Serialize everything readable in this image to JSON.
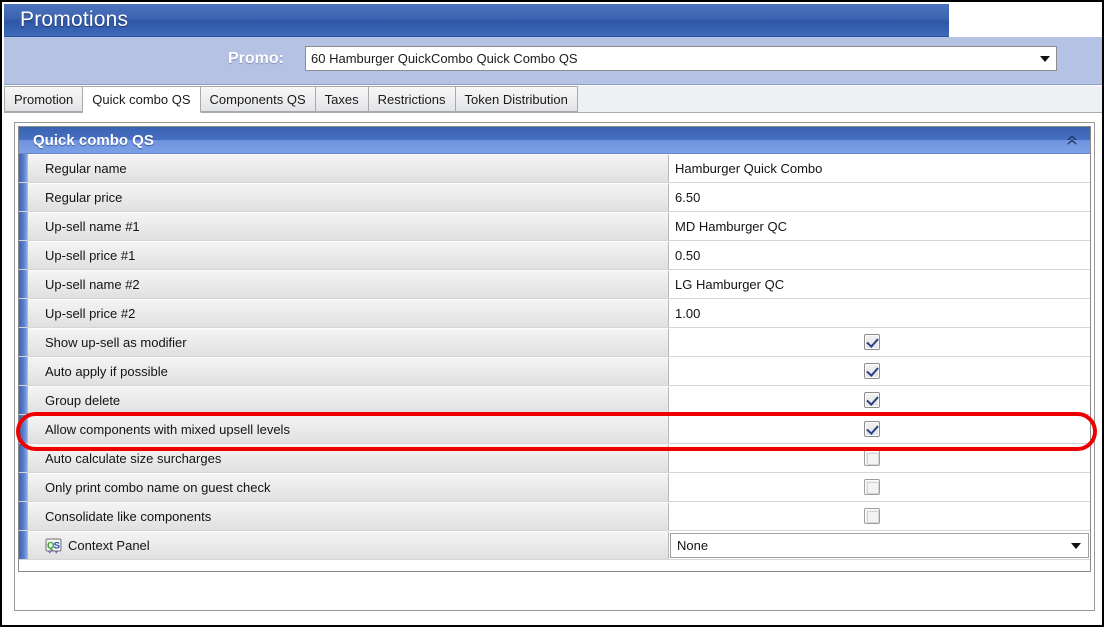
{
  "window": {
    "title": "Promotions"
  },
  "promo": {
    "label": "Promo:",
    "value": "60 Hamburger QuickCombo Quick Combo QS",
    "dropdown_icon": "chevron-down-icon"
  },
  "tabs": [
    {
      "label": "Promotion",
      "active": false
    },
    {
      "label": "Quick combo QS",
      "active": true
    },
    {
      "label": "Components QS",
      "active": false
    },
    {
      "label": "Taxes",
      "active": false
    },
    {
      "label": "Restrictions",
      "active": false
    },
    {
      "label": "Token Distribution",
      "active": false
    }
  ],
  "section": {
    "title": "Quick combo QS",
    "collapse_icon": "double-chevron-up-icon"
  },
  "rows": [
    {
      "label": "Regular name",
      "type": "text",
      "value": "Hamburger Quick Combo"
    },
    {
      "label": "Regular price",
      "type": "text",
      "value": "6.50"
    },
    {
      "label": "Up-sell name #1",
      "type": "text",
      "value": "MD Hamburger QC"
    },
    {
      "label": "Up-sell price #1",
      "type": "text",
      "value": "0.50"
    },
    {
      "label": "Up-sell name #2",
      "type": "text",
      "value": "LG Hamburger QC"
    },
    {
      "label": "Up-sell price #2",
      "type": "text",
      "value": "1.00"
    },
    {
      "label": "Show up-sell as modifier",
      "type": "checkbox",
      "checked": true
    },
    {
      "label": "Auto apply if possible",
      "type": "checkbox",
      "checked": true
    },
    {
      "label": "Group delete",
      "type": "checkbox",
      "checked": true
    },
    {
      "label": "Allow components with mixed upsell levels",
      "type": "checkbox",
      "checked": true,
      "highlighted": true
    },
    {
      "label": "Auto calculate size surcharges",
      "type": "checkbox",
      "checked": false
    },
    {
      "label": "Only print combo name on guest check",
      "type": "checkbox",
      "checked": false
    },
    {
      "label": "Consolidate like components",
      "type": "checkbox",
      "checked": false
    },
    {
      "label": "Context Panel",
      "type": "combo",
      "value": "None",
      "icon": "qs-icon"
    }
  ],
  "annotation": {
    "shape": "ellipse",
    "color": "#ee0000",
    "targets_row": "Allow components with mixed upsell levels"
  },
  "colors": {
    "title_bar": "#3c63b0",
    "promo_bar": "#b6c2e4",
    "section_header": "#4670c2",
    "row_label_bg": "#e9e9e9",
    "annotation": "#ee0000"
  }
}
